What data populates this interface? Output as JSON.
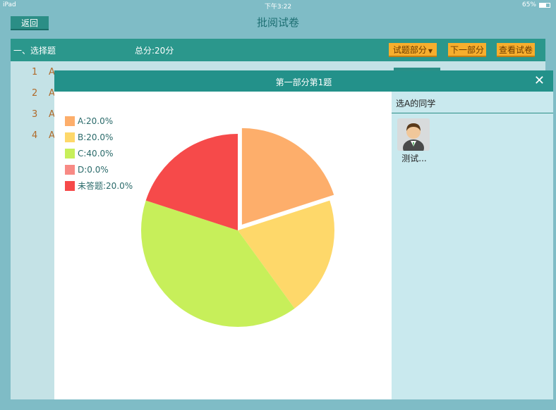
{
  "status": {
    "device": "iPad",
    "time": "下午3:22",
    "battery": "65%",
    "battery_level": 0.65
  },
  "header": {
    "back_label": "返回",
    "title": "批阅试卷"
  },
  "section": {
    "title": "一、选择题",
    "score": "总分:20分",
    "buttons": {
      "questions": "试题部分",
      "next": "下一部分",
      "view": "查看试卷"
    }
  },
  "questions": [
    {
      "num": "1",
      "text": "A"
    },
    {
      "num": "2",
      "text": "A"
    },
    {
      "num": "3",
      "text": "A"
    },
    {
      "num": "4",
      "text": "A"
    }
  ],
  "modal": {
    "title": "第一部分第1题",
    "side_title": "选A的同学",
    "students": [
      {
        "name": "测试..."
      }
    ]
  },
  "chart_data": {
    "type": "pie",
    "slices": [
      {
        "label": "A:20.0%",
        "value": 20.0,
        "color": "#fdae6b",
        "exploded": true
      },
      {
        "label": "B:20.0%",
        "value": 20.0,
        "color": "#fed86a"
      },
      {
        "label": "C:40.0%",
        "value": 40.0,
        "color": "#c7ef5a"
      },
      {
        "label": "D:0.0%",
        "value": 0.0,
        "color": "#f88a85"
      },
      {
        "label": "未答题:20.0%",
        "value": 20.0,
        "color": "#f64a4a"
      }
    ],
    "legend_position": "top-left"
  }
}
